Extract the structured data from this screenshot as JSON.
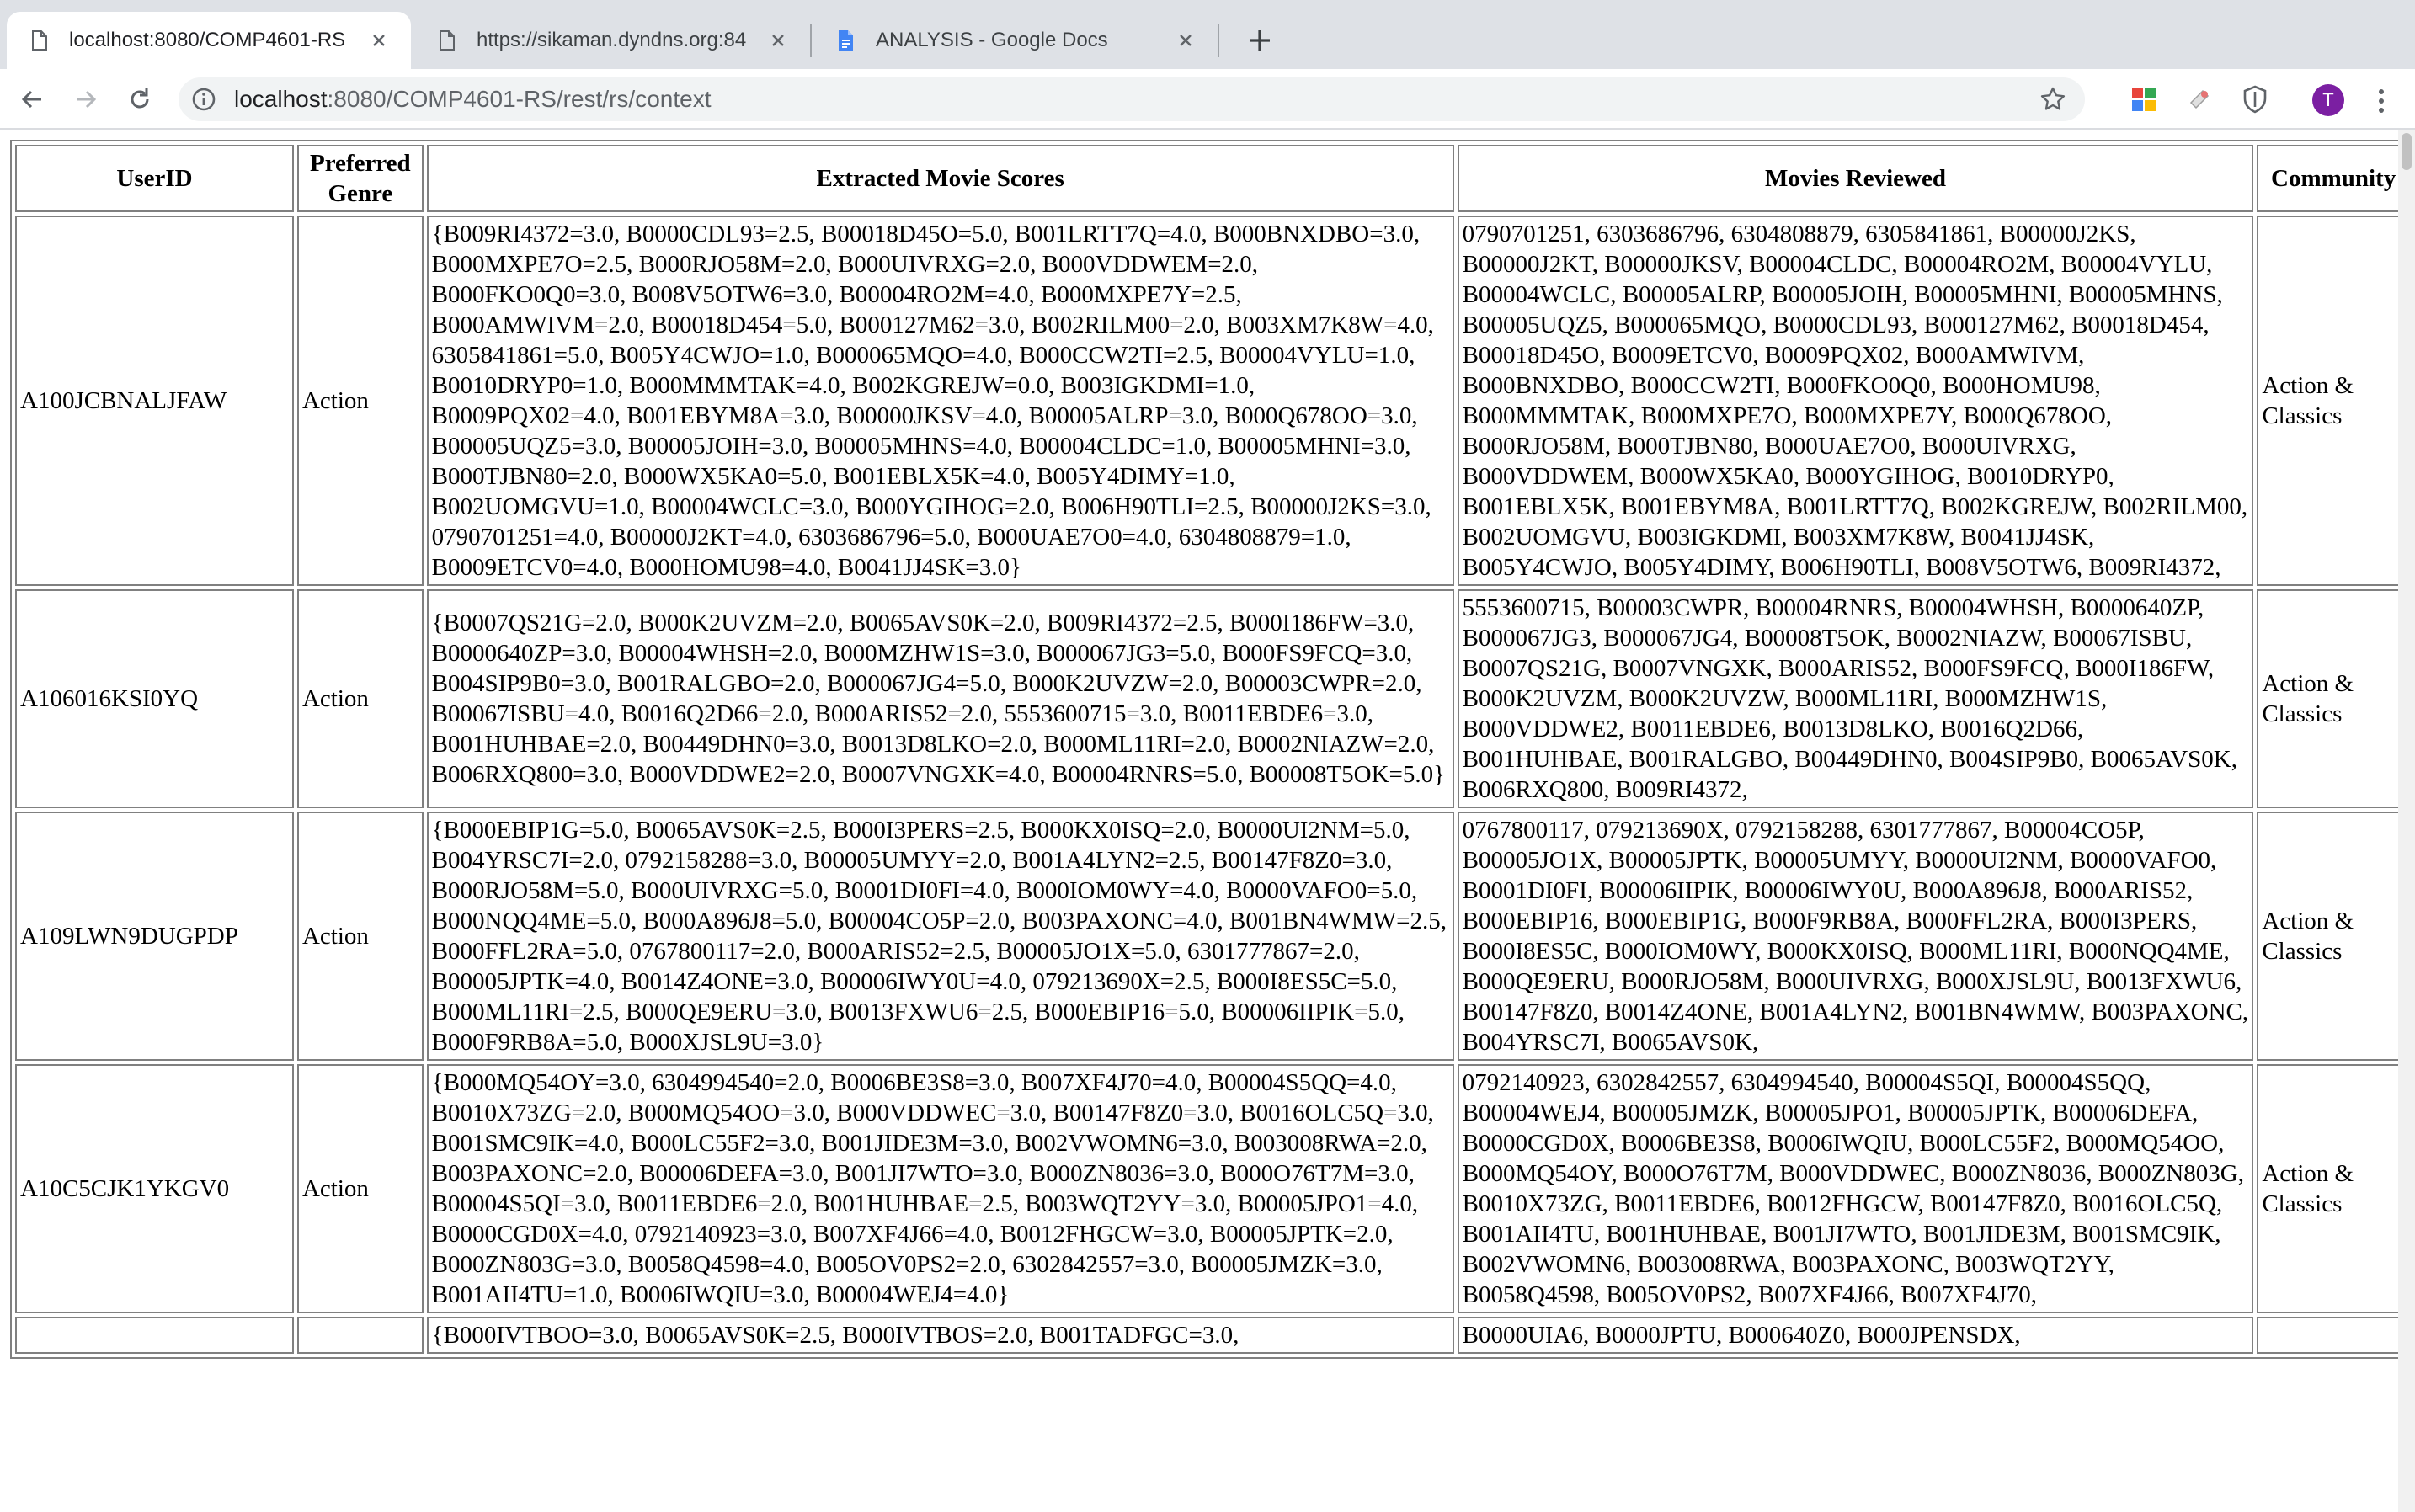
{
  "browser": {
    "tabs": [
      {
        "title": "localhost:8080/COMP4601-RS",
        "active": true
      },
      {
        "title": "https://sikaman.dyndns.org:84",
        "active": false
      },
      {
        "title": "ANALYSIS - Google Docs",
        "active": false
      }
    ],
    "url_host": "localhost",
    "url_path": ":8080/COMP4601-RS/rest/rs/context",
    "avatar_letter": "T"
  },
  "table": {
    "headers": {
      "userid": "UserID",
      "genre": "Preferred Genre",
      "scores": "Extracted Movie Scores",
      "movies": "Movies Reviewed",
      "community": "Community"
    },
    "rows": [
      {
        "userid": "A100JCBNALJFAW",
        "genre": "Action",
        "scores": "{B009RI4372=3.0, B0000CDL93=2.5, B00018D45O=5.0, B001LRTT7Q=4.0, B000BNXDBO=3.0, B000MXPE7O=2.5, B000RJO58M=2.0, B000UIVRXG=2.0, B000VDDWEM=2.0, B000FKO0Q0=3.0, B008V5OTW6=3.0, B00004RO2M=4.0, B000MXPE7Y=2.5, B000AMWIVM=2.0, B00018D454=5.0, B000127M62=3.0, B002RILM00=2.0, B003XM7K8W=4.0, 6305841861=5.0, B005Y4CWJO=1.0, B000065MQO=4.0, B000CCW2TI=2.5, B00004VYLU=1.0, B0010DRYP0=1.0, B000MMMTAK=4.0, B002KGREJW=0.0, B003IGKDMI=1.0, B0009PQX02=4.0, B001EBYM8A=3.0, B00000JKSV=4.0, B00005ALRP=3.0, B000Q678OO=3.0, B00005UQZ5=3.0, B00005JOIH=3.0, B00005MHNS=4.0, B00004CLDC=1.0, B00005MHNI=3.0, B000TJBN80=2.0, B000WX5KA0=5.0, B001EBLX5K=4.0, B005Y4DIMY=1.0, B002UOMGVU=1.0, B00004WCLC=3.0, B000YGIHOG=2.0, B006H90TLI=2.5, B00000J2KS=3.0, 0790701251=4.0, B00000J2KT=4.0, 6303686796=5.0, B000UAE7O0=4.0, 6304808879=1.0, B0009ETCV0=4.0, B000HOMU98=4.0, B0041JJ4SK=3.0}",
        "movies": "0790701251, 6303686796, 6304808879, 6305841861, B00000J2KS, B00000J2KT, B00000JKSV, B00004CLDC, B00004RO2M, B00004VYLU, B00004WCLC, B00005ALRP, B00005JOIH, B00005MHNI, B00005MHNS, B00005UQZ5, B000065MQO, B0000CDL93, B000127M62, B00018D454, B00018D45O, B0009ETCV0, B0009PQX02, B000AMWIVM, B000BNXDBO, B000CCW2TI, B000FKO0Q0, B000HOMU98, B000MMMTAK, B000MXPE7O, B000MXPE7Y, B000Q678OO, B000RJO58M, B000TJBN80, B000UAE7O0, B000UIVRXG, B000VDDWEM, B000WX5KA0, B000YGIHOG, B0010DRYP0, B001EBLX5K, B001EBYM8A, B001LRTT7Q, B002KGREJW, B002RILM00, B002UOMGVU, B003IGKDMI, B003XM7K8W, B0041JJ4SK, B005Y4CWJO, B005Y4DIMY, B006H90TLI, B008V5OTW6, B009RI4372,",
        "community": "Action & Classics"
      },
      {
        "userid": "A106016KSI0YQ",
        "genre": "Action",
        "scores": "{B0007QS21G=2.0, B000K2UVZM=2.0, B0065AVS0K=2.0, B009RI4372=2.5, B000I186FW=3.0, B0000640ZP=3.0, B00004WHSH=2.0, B000MZHW1S=3.0, B000067JG3=5.0, B000FS9FCQ=3.0, B004SIP9B0=3.0, B001RALGBO=2.0, B000067JG4=5.0, B000K2UVZW=2.0, B00003CWPR=2.0, B00067ISBU=4.0, B0016Q2D66=2.0, B000ARIS52=2.0, 5553600715=3.0, B0011EBDE6=3.0, B001HUHBAE=2.0, B00449DHN0=3.0, B0013D8LKO=2.0, B000ML11RI=2.0, B0002NIAZW=2.0, B006RXQ800=3.0, B000VDDWE2=2.0, B0007VNGXK=4.0, B00004RNRS=5.0, B00008T5OK=5.0}",
        "movies": "5553600715, B00003CWPR, B00004RNRS, B00004WHSH, B0000640ZP, B000067JG3, B000067JG4, B00008T5OK, B0002NIAZW, B00067ISBU, B0007QS21G, B0007VNGXK, B000ARIS52, B000FS9FCQ, B000I186FW, B000K2UVZM, B000K2UVZW, B000ML11RI, B000MZHW1S, B000VDDWE2, B0011EBDE6, B0013D8LKO, B0016Q2D66, B001HUHBAE, B001RALGBO, B00449DHN0, B004SIP9B0, B0065AVS0K, B006RXQ800, B009RI4372,",
        "community": "Action & Classics"
      },
      {
        "userid": "A109LWN9DUGPDP",
        "genre": "Action",
        "scores": "{B000EBIP1G=5.0, B0065AVS0K=2.5, B000I3PERS=2.5, B000KX0ISQ=2.0, B0000UI2NM=5.0, B004YRSC7I=2.0, 0792158288=3.0, B00005UMYY=2.0, B001A4LYN2=2.5, B00147F8Z0=3.0, B000RJO58M=5.0, B000UIVRXG=5.0, B0001DI0FI=4.0, B000IOM0WY=4.0, B0000VAFO0=5.0, B000NQQ4ME=5.0, B000A896J8=5.0, B00004CO5P=2.0, B003PAXONC=4.0, B001BN4WMW=2.5, B000FFL2RA=5.0, 0767800117=2.0, B000ARIS52=2.5, B00005JO1X=5.0, 6301777867=2.0, B00005JPTK=4.0, B0014Z4ONE=3.0, B00006IWY0U=4.0, 079213690X=2.5, B000I8ES5C=5.0, B000ML11RI=2.5, B000QE9ERU=3.0, B0013FXWU6=2.5, B000EBIP16=5.0, B00006IIPIK=5.0, B000F9RB8A=5.0, B000XJSL9U=3.0}",
        "movies": "0767800117, 079213690X, 0792158288, 6301777867, B00004CO5P, B00005JO1X, B00005JPTK, B00005UMYY, B0000UI2NM, B0000VAFO0, B0001DI0FI, B00006IIPIK, B00006IWY0U, B000A896J8, B000ARIS52, B000EBIP16, B000EBIP1G, B000F9RB8A, B000FFL2RA, B000I3PERS, B000I8ES5C, B000IOM0WY, B000KX0ISQ, B000ML11RI, B000NQQ4ME, B000QE9ERU, B000RJO58M, B000UIVRXG, B000XJSL9U, B0013FXWU6, B00147F8Z0, B0014Z4ONE, B001A4LYN2, B001BN4WMW, B003PAXONC, B004YRSC7I, B0065AVS0K,",
        "community": "Action & Classics"
      },
      {
        "userid": "A10C5CJK1YKGV0",
        "genre": "Action",
        "scores": "{B000MQ54OY=3.0, 6304994540=2.0, B0006BE3S8=3.0, B007XF4J70=4.0, B00004S5QQ=4.0, B0010X73ZG=2.0, B000MQ54OO=3.0, B000VDDWEC=3.0, B00147F8Z0=3.0, B0016OLC5Q=3.0, B001SMC9IK=4.0, B000LC55F2=3.0, B001JIDE3M=3.0, B002VWOMN6=3.0, B003008RWA=2.0, B003PAXONC=2.0, B00006DEFA=3.0, B001JI7WTO=3.0, B000ZN8036=3.0, B000O76T7M=3.0, B00004S5QI=3.0, B0011EBDE6=2.0, B001HUHBAE=2.5, B003WQT2YY=3.0, B00005JPO1=4.0, B0000CGD0X=4.0, 0792140923=3.0, B007XF4J66=4.0, B0012FHGCW=3.0, B00005JPTK=2.0, B000ZN803G=3.0, B0058Q4598=4.0, B005OV0PS2=2.0, 6302842557=3.0, B00005JMZK=3.0, B001AII4TU=1.0, B0006IWQIU=3.0, B00004WEJ4=4.0}",
        "movies": "0792140923, 6302842557, 6304994540, B00004S5QI, B00004S5QQ, B00004WEJ4, B00005JMZK, B00005JPO1, B00005JPTK, B00006DEFA, B0000CGD0X, B0006BE3S8, B0006IWQIU, B000LC55F2, B000MQ54OO, B000MQ54OY, B000O76T7M, B000VDDWEC, B000ZN8036, B000ZN803G, B0010X73ZG, B0011EBDE6, B0012FHGCW, B00147F8Z0, B0016OLC5Q, B001AII4TU, B001HUHBAE, B001JI7WTO, B001JIDE3M, B001SMC9IK, B002VWOMN6, B003008RWA, B003PAXONC, B003WQT2YY, B0058Q4598, B005OV0PS2, B007XF4J66, B007XF4J70,",
        "community": "Action & Classics"
      },
      {
        "userid": "",
        "genre": "",
        "scores": "{B000IVTBOO=3.0, B0065AVS0K=2.5, B000IVTBOS=2.0, B001TADFGC=3.0,",
        "movies": "B0000UIA6, B0000JPTU, B000640Z0, B000JPENSDX,",
        "community": ""
      }
    ]
  }
}
